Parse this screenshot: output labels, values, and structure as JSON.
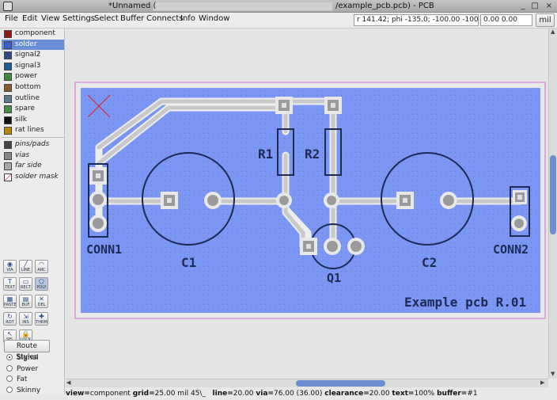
{
  "window": {
    "title_left": "*Unnamed (",
    "title_right": "/example_pcb.pcb) - PCB",
    "minimize": "_",
    "maximize": "□",
    "close": "×"
  },
  "menu": [
    "File",
    "Edit",
    "View",
    "Settings",
    "Select",
    "Buffer",
    "Connects",
    "Info",
    "Window"
  ],
  "status_fields": {
    "polar": "r 141.42; phi -135.0; -100.00 -100.00",
    "coords": "0.00 0.00"
  },
  "units_button": "mil",
  "layers": [
    {
      "label": "component",
      "color": "#8b1a1a",
      "italic": false
    },
    {
      "label": "solder",
      "color": "#3a5fcd",
      "italic": false,
      "selected": true
    },
    {
      "label": "signal2",
      "color": "#2e4a8b",
      "italic": false
    },
    {
      "label": "signal3",
      "color": "#1c5a9a",
      "italic": false
    },
    {
      "label": "power",
      "color": "#3c8b3c",
      "italic": false
    },
    {
      "label": "bottom",
      "color": "#8b5a2b",
      "italic": false
    },
    {
      "label": "outline",
      "color": "#5a7a8b",
      "italic": false
    },
    {
      "label": "spare",
      "color": "#4a8b4a",
      "italic": false
    },
    {
      "label": "silk",
      "color": "#111111",
      "italic": false
    },
    {
      "label": "rat lines",
      "color": "#b8860b",
      "italic": false
    }
  ],
  "special_layers": [
    {
      "label": "pins/pads",
      "color": "#444444"
    },
    {
      "label": "vias",
      "color": "#888888"
    },
    {
      "label": "far side",
      "color": "#aaaaaa"
    },
    {
      "label": "solder mask",
      "color": "#cc2222"
    }
  ],
  "tools": [
    {
      "label": "VIA",
      "icon": "via-icon",
      "glyph": "◉"
    },
    {
      "label": "LINE",
      "icon": "line-icon",
      "glyph": "╱"
    },
    {
      "label": "ARC",
      "icon": "arc-icon",
      "glyph": "◠"
    },
    {
      "label": "TEXT",
      "icon": "text-icon",
      "glyph": "T"
    },
    {
      "label": "RECT",
      "icon": "rect-icon",
      "glyph": "▭"
    },
    {
      "label": "POLY",
      "icon": "poly-icon",
      "glyph": "⬠"
    },
    {
      "label": "PASTE",
      "icon": "paste-icon",
      "glyph": "▦"
    },
    {
      "label": "BUF",
      "icon": "buffer-icon",
      "glyph": "▤"
    },
    {
      "label": "DEL",
      "icon": "delete-icon",
      "glyph": "✕"
    },
    {
      "label": "ROT",
      "icon": "rotate-icon",
      "glyph": "↻"
    },
    {
      "label": "INS",
      "icon": "insert-icon",
      "glyph": "⇲"
    },
    {
      "label": "THRM",
      "icon": "thermal-icon",
      "glyph": "✚"
    },
    {
      "label": "SEL",
      "icon": "select-icon",
      "glyph": "↖"
    },
    {
      "label": "LOCK",
      "icon": "lock-icon",
      "glyph": "🔒"
    }
  ],
  "route_styles_button": "Route Styles",
  "route_styles": [
    {
      "label": "Signal",
      "selected": true
    },
    {
      "label": "Power",
      "selected": false
    },
    {
      "label": "Fat",
      "selected": false
    },
    {
      "label": "Skinny",
      "selected": false
    }
  ],
  "board": {
    "labels": {
      "conn1": "CONN1",
      "conn2": "CONN2",
      "c1": "C1",
      "c2": "C2",
      "r1": "R1",
      "r2": "R2",
      "q1": "Q1",
      "board_text": "Example pcb R.01"
    },
    "colors": {
      "board": "#7b97f3",
      "trace": "#d8d8d8",
      "silk": "#1c2a58",
      "pad": "#9a9a9a"
    }
  },
  "statusbar": {
    "view_k": "view=",
    "view_v": "component",
    "grid_k": "grid=",
    "grid_v": "25.00 mil",
    "angle": "45\\_",
    "line_k": "line=",
    "line_v": "20.00",
    "via_k": "via=",
    "via_v": "76.00 (36.00)",
    "clear_k": "clearance=",
    "clear_v": "20.00",
    "text_k": "text=",
    "text_v": "100%",
    "buffer_k": "buffer=",
    "buffer_v": "#1"
  }
}
